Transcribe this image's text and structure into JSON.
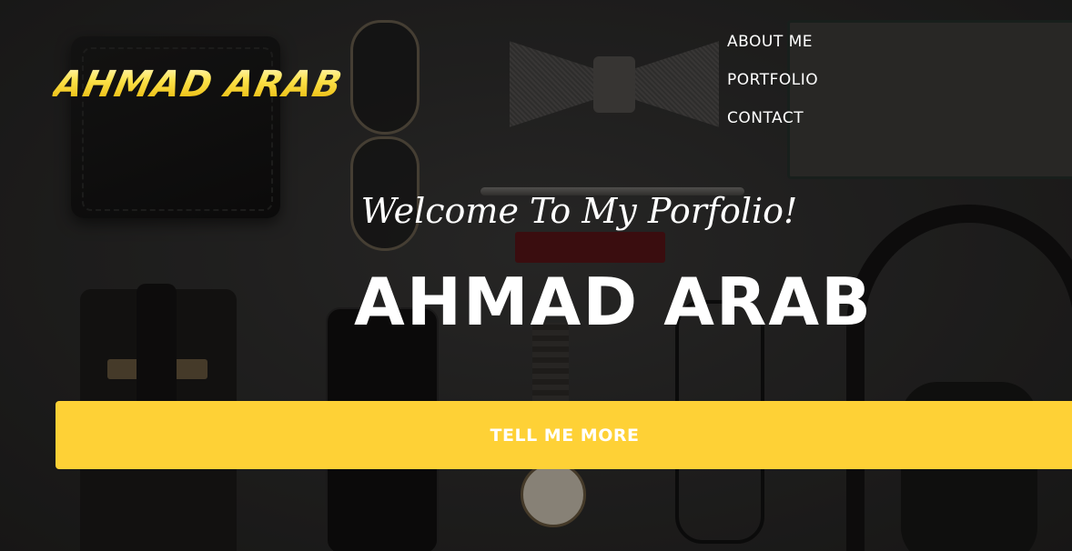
{
  "brand": {
    "logo_text": "AHMAD ARAB"
  },
  "nav": {
    "items": [
      {
        "label": "ABOUT ME"
      },
      {
        "label": "PORTFOLIO"
      },
      {
        "label": "CONTACT"
      }
    ]
  },
  "hero": {
    "subheading": "Welcome To My Porfolio!",
    "heading": "AHMAD ARAB",
    "cta_label": "TELL ME MORE"
  },
  "colors": {
    "accent": "#fed136",
    "text": "#ffffff"
  }
}
